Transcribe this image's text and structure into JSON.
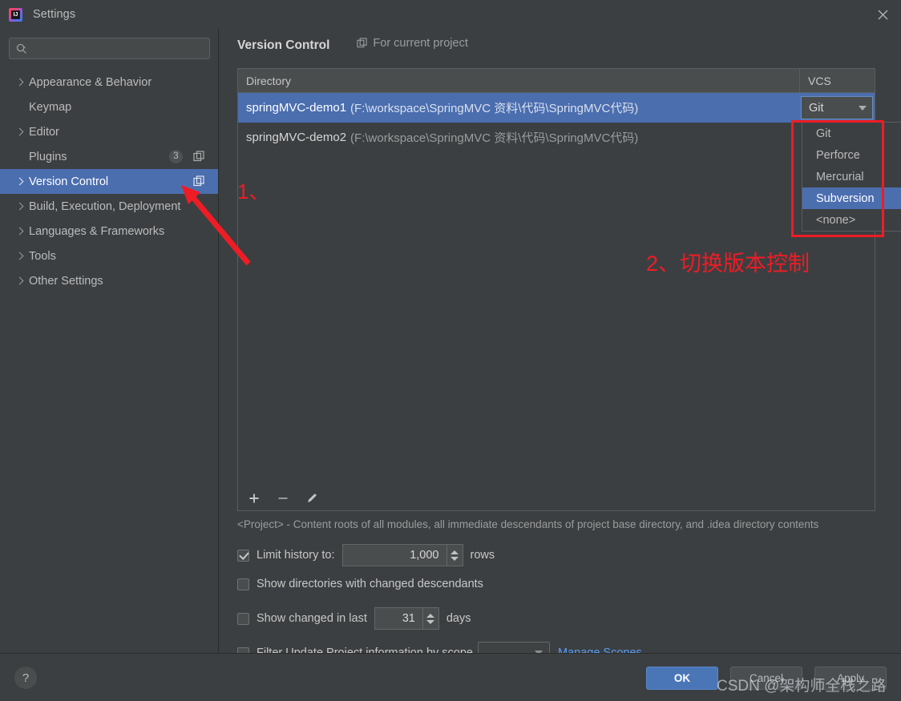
{
  "window": {
    "title": "Settings",
    "app_icon": "intellij-idea-icon",
    "close_icon": "close-icon"
  },
  "search": {
    "value": "",
    "placeholder": "",
    "icon": "search-icon"
  },
  "sidebar": {
    "items": [
      {
        "label": "Appearance & Behavior",
        "expandable": true,
        "selected": false,
        "badge": null,
        "copy_icon": false
      },
      {
        "label": "Keymap",
        "expandable": false,
        "selected": false,
        "badge": null,
        "copy_icon": false
      },
      {
        "label": "Editor",
        "expandable": true,
        "selected": false,
        "badge": null,
        "copy_icon": false
      },
      {
        "label": "Plugins",
        "expandable": false,
        "selected": false,
        "badge": "3",
        "copy_icon": true
      },
      {
        "label": "Version Control",
        "expandable": true,
        "selected": true,
        "badge": null,
        "copy_icon": true
      },
      {
        "label": "Build, Execution, Deployment",
        "expandable": true,
        "selected": false,
        "badge": null,
        "copy_icon": false
      },
      {
        "label": "Languages & Frameworks",
        "expandable": true,
        "selected": false,
        "badge": null,
        "copy_icon": false
      },
      {
        "label": "Tools",
        "expandable": true,
        "selected": false,
        "badge": null,
        "copy_icon": false
      },
      {
        "label": "Other Settings",
        "expandable": true,
        "selected": false,
        "badge": null,
        "copy_icon": false
      }
    ]
  },
  "main": {
    "page_title": "Version Control",
    "scope_note": "For current project",
    "scope_note_icon": "copy-scope-icon",
    "table": {
      "columns": [
        "Directory",
        "VCS"
      ],
      "rows": [
        {
          "name": "springMVC-demo1",
          "path": "(F:\\workspace\\SpringMVC 资料\\代码\\SpringMVC代码)",
          "vcs": "Git",
          "selected": true
        },
        {
          "name": "springMVC-demo2",
          "path": "(F:\\workspace\\SpringMVC 资料\\代码\\SpringMVC代码)",
          "vcs": "",
          "selected": false
        }
      ]
    },
    "toolbar": {
      "add_icon": "plus-icon",
      "remove_icon": "minus-icon",
      "edit_icon": "pencil-icon"
    },
    "project_note": "<Project> - Content roots of all modules, all immediate descendants of project base directory, and .idea directory contents",
    "options": {
      "limit_history_label": "Limit history to:",
      "limit_history_checked": true,
      "limit_history_value": "1,000",
      "limit_history_suffix": "rows",
      "show_dirs_label": "Show directories with changed descendants",
      "show_dirs_checked": false,
      "show_changed_label": "Show changed in last",
      "show_changed_checked": false,
      "show_changed_value": "31",
      "show_changed_suffix": "days",
      "filter_scope_label": "Filter Update Project information by scope",
      "filter_scope_checked": false,
      "filter_scope_value": "",
      "manage_scopes_link": "Manage Scopes"
    }
  },
  "vcs_dropdown": {
    "open": true,
    "options": [
      "Git",
      "Perforce",
      "Mercurial",
      "Subversion",
      "<none>"
    ],
    "highlighted": "Subversion"
  },
  "footer": {
    "help_label": "?",
    "ok_label": "OK",
    "cancel_label": "Cancel",
    "apply_label": "Apply"
  },
  "annotations": {
    "step1": "1、",
    "step2": "2、切换版本控制",
    "arrow": "red-arrow-annotation",
    "box": "red-highlight-box",
    "color": "#ee1c25"
  },
  "watermark": {
    "text": "CSDN @架构师全栈之路"
  }
}
